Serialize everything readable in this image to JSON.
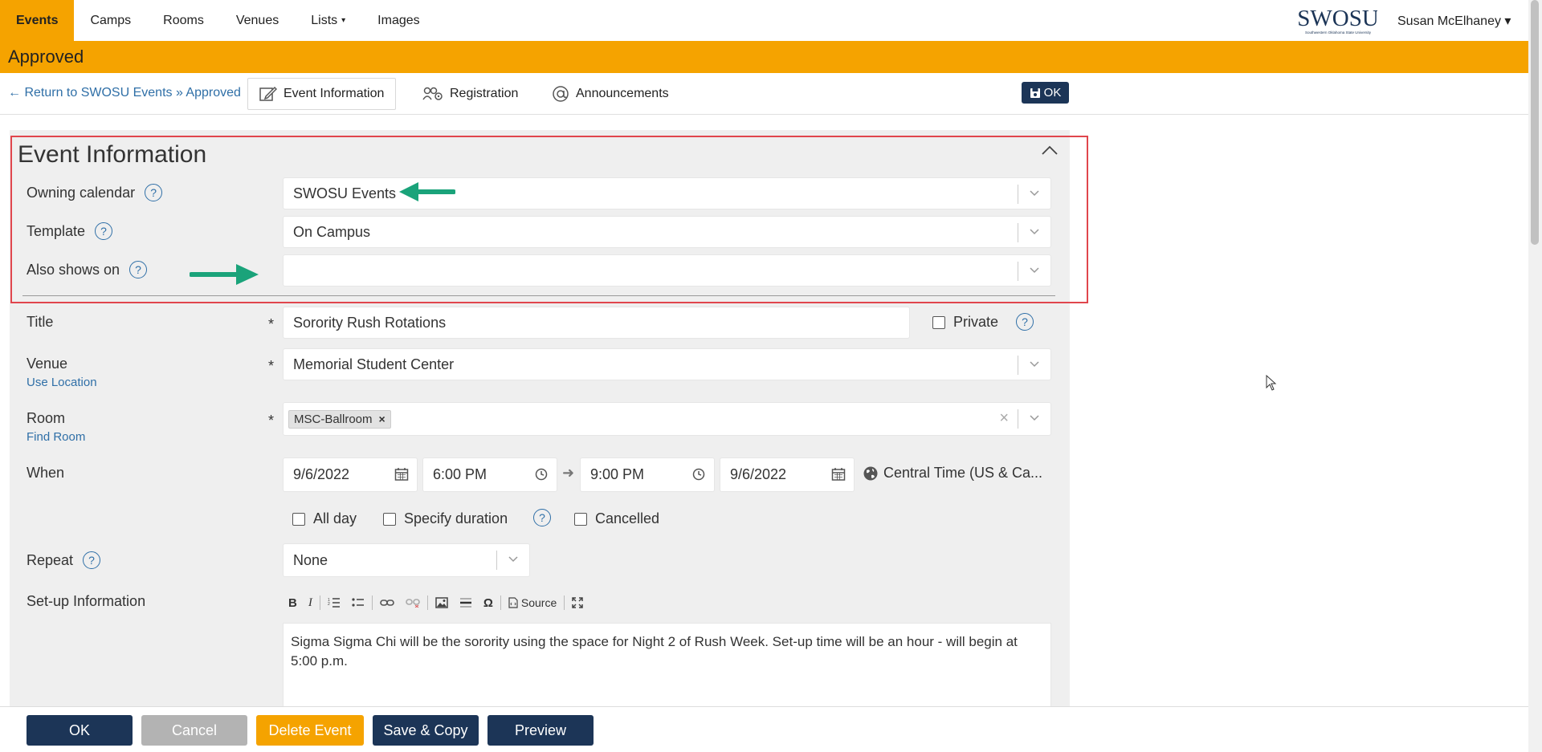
{
  "nav": {
    "items": [
      {
        "label": "Events"
      },
      {
        "label": "Camps"
      },
      {
        "label": "Rooms"
      },
      {
        "label": "Venues"
      },
      {
        "label": "Lists",
        "caret": "▾"
      },
      {
        "label": "Images"
      }
    ],
    "logo_text": "SWOSU",
    "logo_subtext": "Southwestern Oklahoma State University",
    "user": "Susan McElhaney ▾"
  },
  "status": "Approved",
  "subbar": {
    "back_link": "← Return to SWOSU Events » Approved",
    "tabs": [
      "Event Information",
      "Registration",
      "Announcements"
    ],
    "ok_label": "OK"
  },
  "section": {
    "title": "Event Information",
    "owning_calendar_label": "Owning calendar",
    "owning_calendar_value": "SWOSU Events",
    "template_label": "Template",
    "template_value": "On Campus",
    "also_shows_label": "Also shows on",
    "also_shows_value": ""
  },
  "form": {
    "required_mark": "*",
    "help_mark": "?",
    "title_label": "Title",
    "title_value": "Sorority Rush Rotations",
    "private_label": "Private",
    "venue_label": "Venue",
    "venue_link": "Use Location",
    "venue_value": "Memorial Student Center",
    "room_label": "Room",
    "room_link": "Find Room",
    "room_tag": "MSC-Ballroom",
    "tag_remove": "×",
    "clear_mark": "×",
    "when_label": "When",
    "start_date": "9/6/2022",
    "start_time": "6:00 PM",
    "time_arrow": "➜",
    "end_time": "9:00 PM",
    "end_date": "9/6/2022",
    "timezone": "Central Time (US & Ca...",
    "all_day": "All day",
    "specify_duration": "Specify duration",
    "cancelled": "Cancelled",
    "repeat_label": "Repeat",
    "repeat_value": "None",
    "setup_label": "Set-up Information",
    "setup_text": "Sigma Sigma Chi will be the sorority using the space for Night 2 of Rush Week. Set-up time will be an hour - will begin at 5:00 p.m.",
    "editor": {
      "bold": "B",
      "italic": "I",
      "omega": "Ω",
      "source": "Source"
    }
  },
  "buttons": {
    "ok": "OK",
    "cancel": "Cancel",
    "delete": "Delete Event",
    "save_copy": "Save & Copy",
    "preview": "Preview"
  },
  "colors": {
    "brand_orange": "#f5a300",
    "navy": "#1c3557",
    "link_blue": "#2f6fa7",
    "highlight_red": "#e0464d",
    "arrow_green": "#1aa37a"
  }
}
